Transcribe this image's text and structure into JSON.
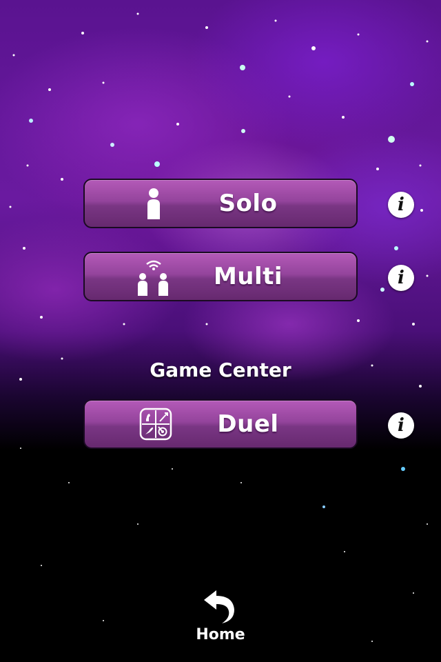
{
  "menu": {
    "solo": {
      "label": "Solo",
      "icon": "single-person-icon"
    },
    "multi": {
      "label": "Multi",
      "icon": "two-people-wifi-icon"
    },
    "duel": {
      "label": "Duel",
      "icon": "game-center-duel-icon"
    },
    "info_glyph": "i"
  },
  "game_center": {
    "title": "Game Center"
  },
  "home": {
    "label": "Home",
    "icon": "back-arrow-icon"
  },
  "colors": {
    "button_top": "#b45ab8",
    "button_bottom": "#66296f",
    "text": "#ffffff",
    "info_bg": "#ffffff"
  }
}
